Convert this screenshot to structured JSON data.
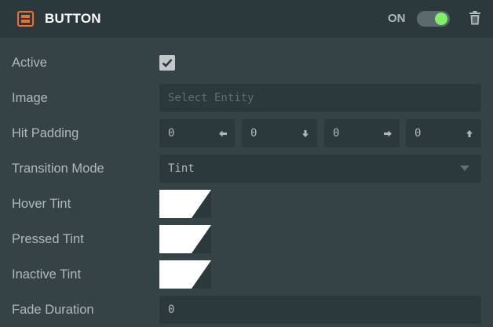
{
  "header": {
    "title": "BUTTON",
    "toggle_label": "ON",
    "toggle_state": "on",
    "accent_color": "#7ef167",
    "brand_color": "#f46d2b",
    "icons": [
      "button-component-icon",
      "trash-icon"
    ]
  },
  "fields": {
    "active": {
      "label": "Active",
      "checked": true
    },
    "image": {
      "label": "Image",
      "placeholder": "Select Entity"
    },
    "hit_padding": {
      "label": "Hit Padding",
      "values": [
        "0",
        "0",
        "0",
        "0"
      ],
      "icons": [
        "arrow-left-icon",
        "arrow-down-icon",
        "arrow-right-icon",
        "arrow-up-icon"
      ]
    },
    "transition_mode": {
      "label": "Transition Mode",
      "value": "Tint"
    },
    "hover_tint": {
      "label": "Hover Tint",
      "color": "#ffffff"
    },
    "pressed_tint": {
      "label": "Pressed Tint",
      "color": "#ffffff"
    },
    "inactive_tint": {
      "label": "Inactive Tint",
      "color": "#ffffff"
    },
    "fade_duration": {
      "label": "Fade Duration",
      "value": "0"
    }
  }
}
